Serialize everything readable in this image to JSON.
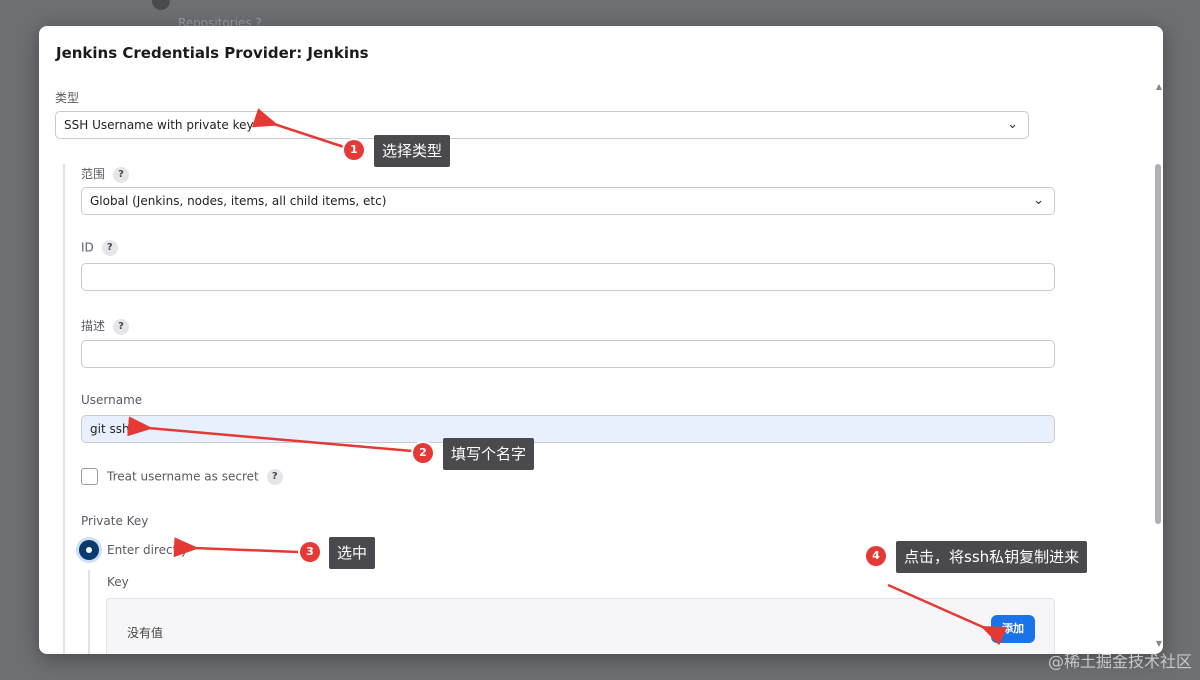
{
  "backdrop": {
    "text": "Repositories  ?"
  },
  "dialog": {
    "title": "Jenkins Credentials Provider: Jenkins",
    "kind": {
      "label": "类型",
      "value": "SSH Username with private key"
    },
    "scope": {
      "label": "范围",
      "help": "?",
      "value": "Global (Jenkins, nodes, items, all child items, etc)"
    },
    "id": {
      "label": "ID",
      "help": "?",
      "value": ""
    },
    "description": {
      "label": "描述",
      "help": "?",
      "value": ""
    },
    "username": {
      "label": "Username",
      "value": "git ssh"
    },
    "treat_secret": {
      "label": "Treat username as secret",
      "help": "?",
      "checked": false
    },
    "private_key": {
      "label": "Private Key",
      "option": "Enter directly",
      "key_label": "Key",
      "empty_text": "没有值",
      "add_label": "添加"
    }
  },
  "annotations": [
    {
      "num": "1",
      "text": "选择类型"
    },
    {
      "num": "2",
      "text": "填写个名字"
    },
    {
      "num": "3",
      "text": "选中"
    },
    {
      "num": "4",
      "text": "点击，将ssh私钥复制进来"
    }
  ],
  "watermark": "@稀土掘金技术社区",
  "colors": {
    "accent": "#1a73e8",
    "annotation": "#e53935",
    "tag_bg": "#4a4a4e"
  },
  "icons": [
    "chevron-down-icon",
    "help-icon",
    "radio-selected-icon",
    "scroll-up-icon",
    "scroll-down-icon"
  ]
}
